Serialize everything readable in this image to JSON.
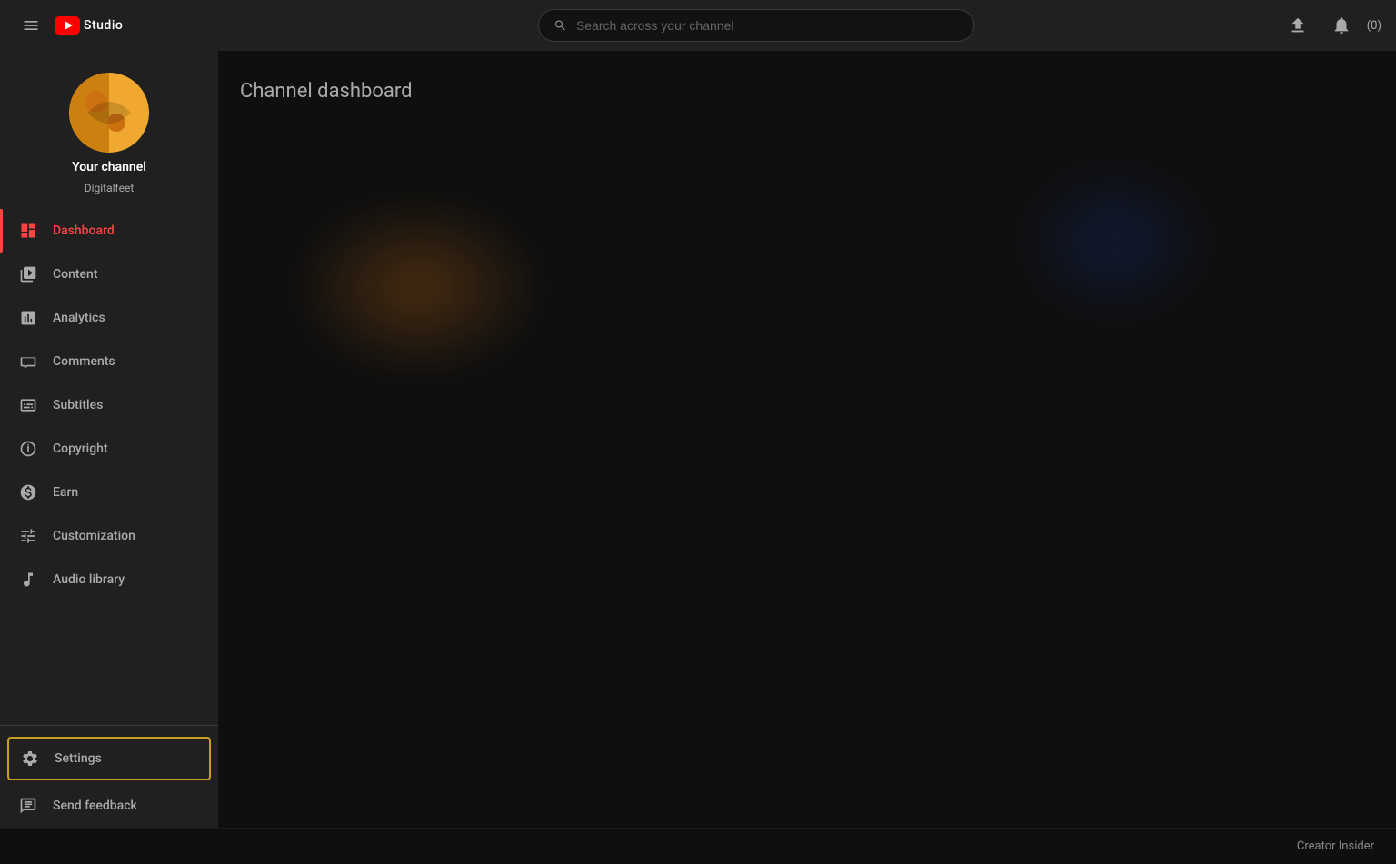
{
  "header": {
    "menu_label": "Menu",
    "logo_text": "Studio",
    "search_placeholder": "Search across your channel",
    "upload_label": "Upload",
    "notification_label": "Notifications",
    "notification_count": "(0)"
  },
  "channel": {
    "title": "Your channel",
    "handle": "Digitalfeet"
  },
  "nav": {
    "dashboard_label": "Dashboard",
    "content_label": "Content",
    "analytics_label": "Analytics",
    "comments_label": "Comments",
    "subtitles_label": "Subtitles",
    "copyright_label": "Copyright",
    "earn_label": "Earn",
    "customization_label": "Customization",
    "audio_library_label": "Audio library",
    "settings_label": "Settings",
    "send_feedback_label": "Send feedback"
  },
  "page": {
    "title": "Channel dashboard"
  },
  "footer": {
    "creator_insider": "Creator Insider"
  }
}
